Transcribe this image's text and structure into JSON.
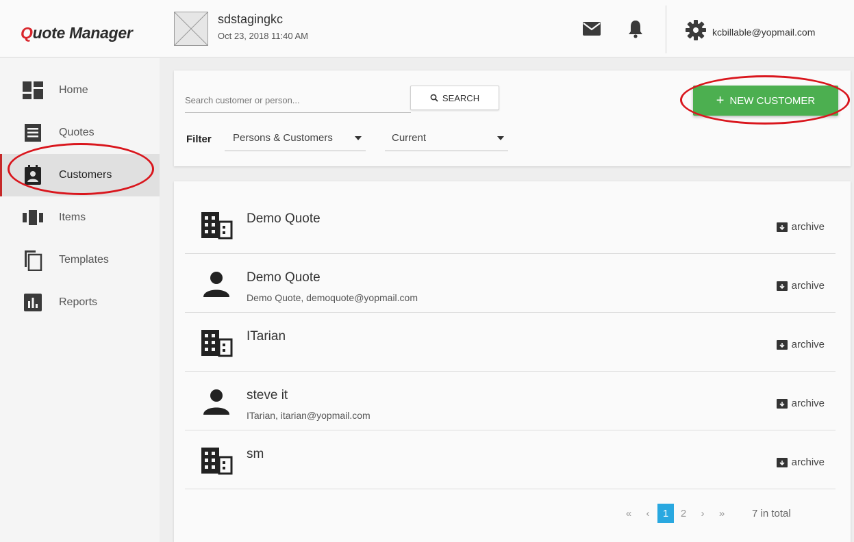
{
  "header": {
    "brand_q": "Q",
    "brand_rest": "uote Manager",
    "org_name": "sdstagingkc",
    "org_date": "Oct 23, 2018 11:40 AM",
    "user_email": "kcbillable@yopmail.com"
  },
  "sidebar": {
    "items": [
      {
        "label": "Home",
        "icon": "dashboard-icon"
      },
      {
        "label": "Quotes",
        "icon": "quotes-icon"
      },
      {
        "label": "Customers",
        "icon": "customers-icon"
      },
      {
        "label": "Items",
        "icon": "items-icon"
      },
      {
        "label": "Templates",
        "icon": "templates-icon"
      },
      {
        "label": "Reports",
        "icon": "reports-icon"
      }
    ],
    "active": "Customers"
  },
  "toolbar": {
    "search_placeholder": "Search customer or person...",
    "search_label": "SEARCH",
    "new_customer_label": "NEW CUSTOMER",
    "filter_label": "Filter",
    "filter_type": "Persons & Customers",
    "filter_status": "Current"
  },
  "customers": [
    {
      "name": "Demo Quote",
      "sub": "",
      "type": "company",
      "action": "archive"
    },
    {
      "name": "Demo Quote",
      "sub": "Demo Quote, demoquote@yopmail.com",
      "type": "person",
      "action": "archive"
    },
    {
      "name": "ITarian",
      "sub": "",
      "type": "company",
      "action": "archive"
    },
    {
      "name": "steve it",
      "sub": "ITarian, itarian@yopmail.com",
      "type": "person",
      "action": "archive"
    },
    {
      "name": "sm",
      "sub": "",
      "type": "company",
      "action": "archive"
    }
  ],
  "pagination": {
    "first": "«",
    "prev": "‹",
    "pages": [
      "1",
      "2"
    ],
    "current": "1",
    "next": "›",
    "last": "»",
    "total": "7 in total"
  },
  "colors": {
    "accent_green": "#4caf50",
    "annotation_red": "#d9161d",
    "page_active_blue": "#29a8e0",
    "brand_red": "#d9262c"
  }
}
